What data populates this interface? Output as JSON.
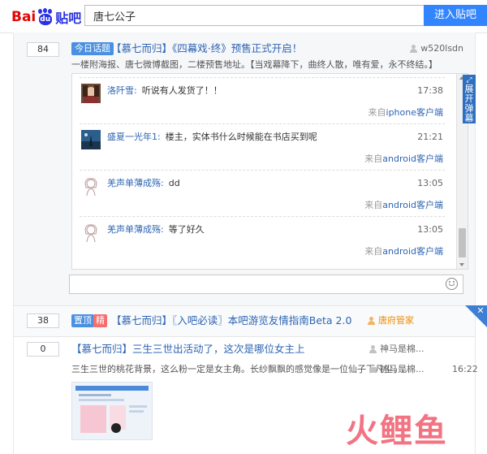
{
  "header": {
    "logo_bai": "Bai",
    "logo_du": "du",
    "logo_tieba": "贴吧",
    "search_value": "唐七公子",
    "enter_button": "进入贴吧"
  },
  "threads": [
    {
      "reply_count": "84",
      "tag": "今日话题",
      "title": "【慕七而归】《四幕戏·终》预售正式开启！",
      "author": "w520lsdn",
      "abstract": "一楼附海报、唐七微博截图，二楼预售地址。【当戏幕降下，曲终人散，唯有爱，永不终结。】",
      "expand_label": "展开弹幕",
      "comments": [
        {
          "name": "洛阡雪:",
          "text": "听说有人发货了！！",
          "time": "17:38",
          "source_prefix": "来自",
          "source": "iphone客户端"
        },
        {
          "name": "盛夏一光年1:",
          "text": "楼主，实体书什么时候能在书店买到呢",
          "time": "21:21",
          "source_prefix": "来自",
          "source": "android客户端"
        },
        {
          "name": "羌声单薄成殇:",
          "text": "dd",
          "time": "13:05",
          "source_prefix": "来自",
          "source": "android客户端"
        },
        {
          "name": "羌声单薄成殇:",
          "text": "等了好久",
          "time": "13:05",
          "source_prefix": "来自",
          "source": "android客户端"
        }
      ]
    },
    {
      "reply_count": "38",
      "tag_top": "置顶",
      "tag_jing": "精",
      "title": "【慕七而归】〖入吧必读〗本吧游览友情指南Beta 2.0",
      "author": "唐府管家",
      "close_glyph": "✕"
    },
    {
      "reply_count": "0",
      "title": "【慕七而归】三生三世出活动了，这次是哪位女主上",
      "author": "神马是棉...",
      "abstract": "三生三世的桃花背景，这么粉一定是女主角。长纱飘飘的感觉像是一位仙子下凡尘，...",
      "last_replier": "神马是棉...",
      "last_time": "16:22"
    }
  ],
  "watermark": "火鲤鱼",
  "colors": {
    "link": "#2d64b3",
    "accent": "#3385ff",
    "tag_blue": "#4a90e2",
    "tag_red": "#f76d6d",
    "manager": "#f08c00",
    "watermark": "#f26d7d"
  }
}
